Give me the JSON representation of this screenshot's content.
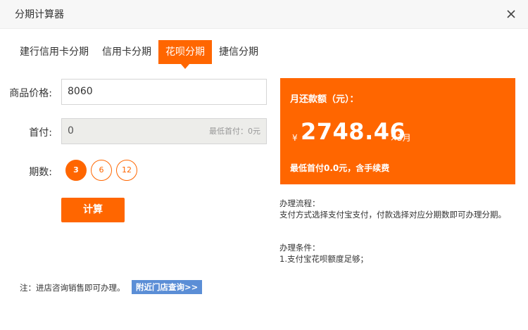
{
  "dialog": {
    "title": "分期计算器"
  },
  "tabs": [
    {
      "label": "建行信用卡分期"
    },
    {
      "label": "信用卡分期"
    },
    {
      "label": "花呗分期"
    },
    {
      "label": "捷信分期"
    }
  ],
  "form": {
    "price_label": "商品价格:",
    "price_value": "8060",
    "down_label": "首付:",
    "down_value": "0",
    "down_hint": "最低首付：0元",
    "periods_label": "期数:",
    "periods": [
      "3",
      "6",
      "12"
    ],
    "selected_period": "3",
    "calc_button": "计算"
  },
  "result": {
    "title": "月还款额（元）：",
    "currency": "¥",
    "amount": "2748.46",
    "multiplier": "×3月",
    "note": "最低首付0.0元，含手续费"
  },
  "process": {
    "heading": "办理流程：",
    "text": "支付方式选择支付宝支付，付款选择对应分期数即可办理分期。"
  },
  "conditions": {
    "heading": "办理条件：",
    "text": "1.支付宝花呗额度足够；"
  },
  "footer": {
    "note": "注：进店咨询销售即可办理。",
    "store_link": "附近门店查询>>"
  },
  "colors": {
    "accent": "#ff6600",
    "link_bg": "#5b8ed6"
  }
}
